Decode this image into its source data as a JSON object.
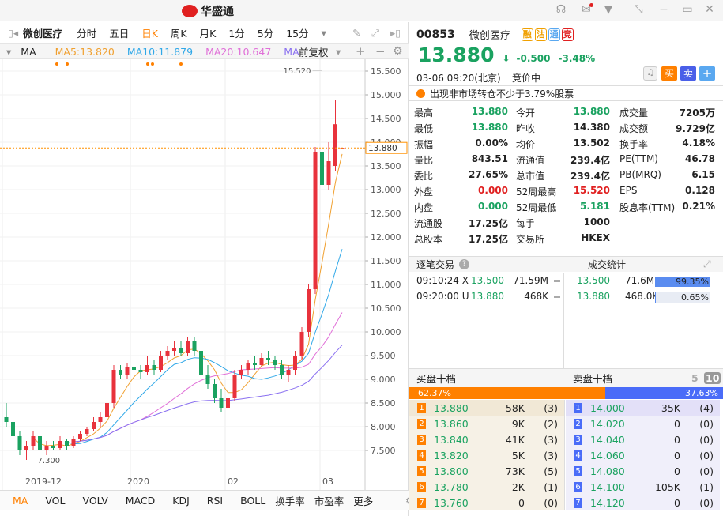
{
  "app": {
    "title": "华盛通",
    "window_buttons": [
      "headset-icon",
      "mail-icon",
      "shirt-icon",
      "shrink-icon",
      "minimize-icon",
      "maximize-icon",
      "close-icon"
    ]
  },
  "toolbar": {
    "stock": "微创医疗",
    "periods": [
      "分时",
      "五日",
      "日K",
      "周K",
      "月K",
      "1分",
      "5分",
      "15分"
    ],
    "active_period": "日K"
  },
  "indicators": {
    "name": "MA",
    "ma5": "MA5:13.820",
    "ma10": "MA10:11.879",
    "ma20": "MA20:10.647",
    "ma60": "MA",
    "adjust": "前复权"
  },
  "colors": {
    "up": "#e8323c",
    "down": "#1aa260",
    "ma5": "#f0a030",
    "ma10": "#30a8e8",
    "ma20": "#e070d8",
    "ma60": "#8a70f0",
    "accent": "#ff8000"
  },
  "chart_data": {
    "type": "candlestick",
    "ylim": [
      7.2,
      15.8
    ],
    "yticks": [
      "15.500",
      "15.000",
      "14.500",
      "14.000",
      "13.500",
      "13.000",
      "12.500",
      "12.000",
      "11.500",
      "11.000",
      "10.500",
      "10.000",
      "9.500",
      "9.000",
      "8.500",
      "8.000",
      "7.500"
    ],
    "xticks": [
      "2019-12",
      "2020",
      "02",
      "03"
    ],
    "max_label": "15.520",
    "min_label": "7.300",
    "current_price": "13.880",
    "candles": [
      [
        8.2,
        8.5,
        8.0,
        8.1
      ],
      [
        8.1,
        8.2,
        7.7,
        7.8
      ],
      [
        7.8,
        7.9,
        7.4,
        7.5
      ],
      [
        7.5,
        7.7,
        7.3,
        7.6
      ],
      [
        7.6,
        7.9,
        7.5,
        7.8
      ],
      [
        7.8,
        7.9,
        7.4,
        7.5
      ],
      [
        7.5,
        7.7,
        7.4,
        7.6
      ],
      [
        7.6,
        7.7,
        7.5,
        7.55
      ],
      [
        7.55,
        7.8,
        7.5,
        7.7
      ],
      [
        7.7,
        7.75,
        7.5,
        7.6
      ],
      [
        7.6,
        7.8,
        7.55,
        7.75
      ],
      [
        7.75,
        7.9,
        7.7,
        7.85
      ],
      [
        7.85,
        8.0,
        7.8,
        7.95
      ],
      [
        7.95,
        8.2,
        7.9,
        8.1
      ],
      [
        8.1,
        8.3,
        8.0,
        8.2
      ],
      [
        8.2,
        8.6,
        8.1,
        8.5
      ],
      [
        8.5,
        9.3,
        8.4,
        9.2
      ],
      [
        9.2,
        9.3,
        9.0,
        9.1
      ],
      [
        9.1,
        9.35,
        9.0,
        9.25
      ],
      [
        9.25,
        9.4,
        9.1,
        9.2
      ],
      [
        9.2,
        9.3,
        9.0,
        9.15
      ],
      [
        9.15,
        9.5,
        9.1,
        9.3
      ],
      [
        9.3,
        9.4,
        9.1,
        9.2
      ],
      [
        9.2,
        9.6,
        9.15,
        9.5
      ],
      [
        9.5,
        9.7,
        9.4,
        9.6
      ],
      [
        9.6,
        9.8,
        9.5,
        9.65
      ],
      [
        9.65,
        9.8,
        9.5,
        9.55
      ],
      [
        9.55,
        9.9,
        9.5,
        9.8
      ],
      [
        9.8,
        9.9,
        9.5,
        9.6
      ],
      [
        9.6,
        9.7,
        9.0,
        9.1
      ],
      [
        9.1,
        9.3,
        8.8,
        8.9
      ],
      [
        8.9,
        9.0,
        8.5,
        8.6
      ],
      [
        8.6,
        8.8,
        8.3,
        8.4
      ],
      [
        8.4,
        8.7,
        8.35,
        8.6
      ],
      [
        8.6,
        9.2,
        8.55,
        9.1
      ],
      [
        9.1,
        9.3,
        9.0,
        9.2
      ],
      [
        9.2,
        9.4,
        9.1,
        9.35
      ],
      [
        9.35,
        9.5,
        9.2,
        9.3
      ],
      [
        9.3,
        9.55,
        9.25,
        9.45
      ],
      [
        9.45,
        9.6,
        9.3,
        9.4
      ],
      [
        9.4,
        9.5,
        9.2,
        9.3
      ],
      [
        9.3,
        9.4,
        9.0,
        9.1
      ],
      [
        9.1,
        9.3,
        8.95,
        9.2
      ],
      [
        9.2,
        9.6,
        9.1,
        9.5
      ],
      [
        9.5,
        10.1,
        9.4,
        10.0
      ],
      [
        10.0,
        11.0,
        9.9,
        10.9
      ],
      [
        10.9,
        13.9,
        10.8,
        13.8
      ],
      [
        13.8,
        15.52,
        13.0,
        13.1
      ],
      [
        13.1,
        14.0,
        13.0,
        13.6
      ],
      [
        13.5,
        14.9,
        13.4,
        14.38
      ],
      [
        13.88,
        13.88,
        13.88,
        13.88
      ]
    ]
  },
  "bottom_tabs": [
    "MA",
    "VOL",
    "VOLV",
    "MACD",
    "KDJ",
    "RSI",
    "BOLL",
    "换手率",
    "市盈率",
    "更多"
  ],
  "quote": {
    "code": "00853",
    "name": "微创医疗",
    "tags": [
      "融",
      "沽",
      "通",
      "竞"
    ],
    "price": "13.880",
    "change": "-0.500",
    "change_pct": "-3.48%",
    "time": "03-06  09:20(北京)",
    "status": "竞价中",
    "buy": "买",
    "sell": "卖",
    "notice": "出现非市场转仓不少于3.79%股票"
  },
  "stats": [
    [
      [
        "最高",
        "13.880",
        "green"
      ],
      [
        "今开",
        "13.880",
        "green"
      ],
      [
        "成交量",
        "7205万",
        ""
      ]
    ],
    [
      [
        "最低",
        "13.880",
        "green"
      ],
      [
        "昨收",
        "14.380",
        ""
      ],
      [
        "成交额",
        "9.729亿",
        ""
      ]
    ],
    [
      [
        "振幅",
        "0.00%",
        ""
      ],
      [
        "均价",
        "13.502",
        ""
      ],
      [
        "换手率",
        "4.18%",
        ""
      ]
    ],
    [
      [
        "量比",
        "843.51",
        ""
      ],
      [
        "流通值",
        "239.4亿",
        ""
      ],
      [
        "PE(TTM)",
        "46.78",
        ""
      ]
    ],
    [
      [
        "委比",
        "27.65%",
        ""
      ],
      [
        "总市值",
        "239.4亿",
        ""
      ],
      [
        "PB(MRQ)",
        "6.15",
        ""
      ]
    ],
    [
      [
        "外盘",
        "0.000",
        "red"
      ],
      [
        "52周最高",
        "15.520",
        "red"
      ],
      [
        "EPS",
        "0.128",
        ""
      ]
    ],
    [
      [
        "内盘",
        "0.000",
        "green"
      ],
      [
        "52周最低",
        "5.181",
        "green"
      ],
      [
        "股息率(TTM)",
        "0.21%",
        ""
      ]
    ],
    [
      [
        "流通股",
        "17.25亿",
        ""
      ],
      [
        "每手",
        "1000",
        ""
      ],
      [
        "",
        "",
        " "
      ]
    ],
    [
      [
        "总股本",
        "17.25亿",
        ""
      ],
      [
        "交易所",
        "HKEX",
        ""
      ],
      [
        "",
        "",
        " "
      ]
    ]
  ],
  "ticks": {
    "title": "逐笔交易",
    "rows": [
      [
        "09:10:24 X",
        "13.500",
        "71.59M"
      ],
      [
        "09:20:00 U",
        "13.880",
        "468K"
      ]
    ]
  },
  "deal_stats": {
    "title": "成交统计",
    "rows": [
      [
        "13.500",
        "71.6M",
        "99.35%",
        99.35
      ],
      [
        "13.880",
        "468.0K",
        "0.65%",
        0.65
      ]
    ]
  },
  "book": {
    "bid_title": "买盘十档",
    "ask_title": "卖盘十档",
    "five": "5",
    "ten": "10",
    "bid_pct": "62.37%",
    "ask_pct": "37.63%",
    "bid_ratio": 62.37,
    "bids": [
      [
        "1",
        "13.880",
        "58K",
        "(3)"
      ],
      [
        "2",
        "13.860",
        "9K",
        "(2)"
      ],
      [
        "3",
        "13.840",
        "41K",
        "(3)"
      ],
      [
        "4",
        "13.820",
        "5K",
        "(3)"
      ],
      [
        "5",
        "13.800",
        "73K",
        "(5)"
      ],
      [
        "6",
        "13.780",
        "2K",
        "(1)"
      ],
      [
        "7",
        "13.760",
        "0",
        "(0)"
      ]
    ],
    "asks": [
      [
        "1",
        "14.000",
        "35K",
        "(4)"
      ],
      [
        "2",
        "14.020",
        "0",
        "(0)"
      ],
      [
        "3",
        "14.040",
        "0",
        "(0)"
      ],
      [
        "4",
        "14.060",
        "0",
        "(0)"
      ],
      [
        "5",
        "14.080",
        "0",
        "(0)"
      ],
      [
        "6",
        "14.100",
        "105K",
        "(1)"
      ],
      [
        "7",
        "14.120",
        "0",
        "(0)"
      ]
    ]
  }
}
